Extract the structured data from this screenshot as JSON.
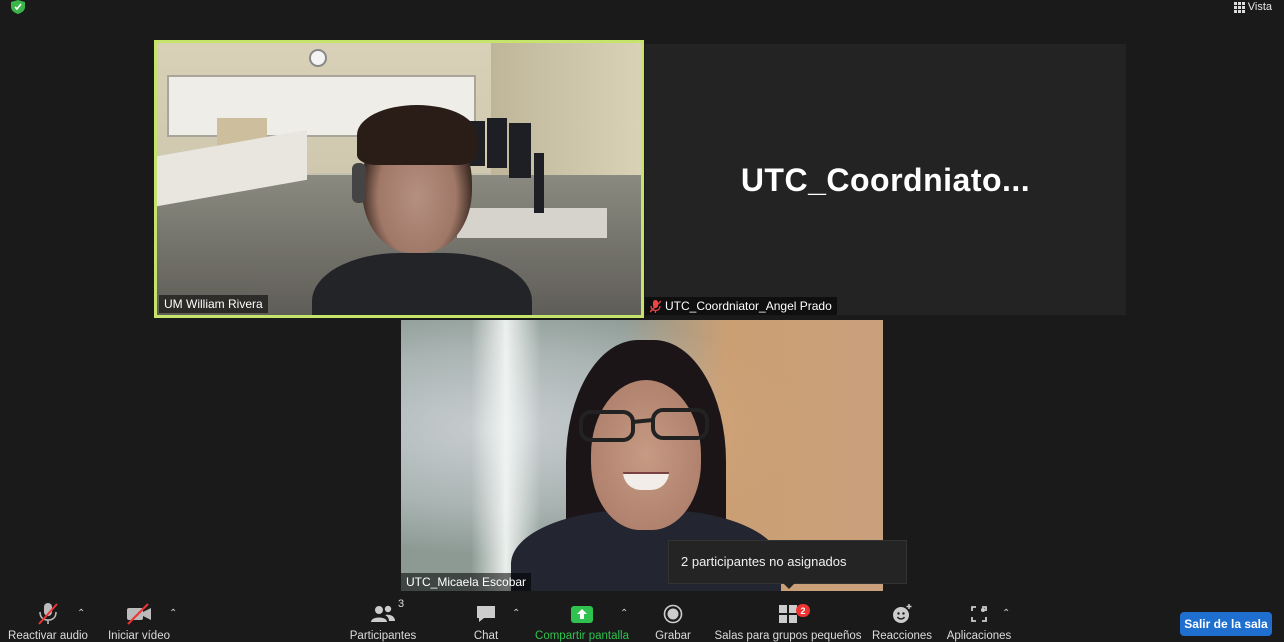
{
  "top_bar": {
    "view_label": "Vista",
    "icons": [
      "shield-icon",
      "grid-icon"
    ],
    "shield_color": "#3ab54a"
  },
  "participants": [
    {
      "name": "UM William Rivera",
      "video": true,
      "active_speaker": true,
      "highlight_color": "#c6e46b"
    },
    {
      "name": "UTC_Coordniator_Angel Prado",
      "display_name": "UTC_Coordniato...",
      "video": false,
      "muted": true
    },
    {
      "name": "UTC_Micaela Escobar",
      "video": true
    }
  ],
  "tooltip": {
    "text": "2 participantes no asignados"
  },
  "toolbar": {
    "audio": {
      "label": "Reactivar audio",
      "icon": "mic-muted-icon"
    },
    "video": {
      "label": "Iniciar vídeo",
      "icon": "video-off-icon"
    },
    "participants": {
      "label": "Participantes",
      "count": "3",
      "icon": "people-icon"
    },
    "chat": {
      "label": "Chat",
      "icon": "chat-icon"
    },
    "share": {
      "label": "Compartir pantalla",
      "icon": "share-screen-icon",
      "color": "#2fc24e"
    },
    "record": {
      "label": "Grabar",
      "icon": "record-icon"
    },
    "breakout": {
      "label": "Salas para grupos pequeños",
      "badge": "2",
      "icon": "breakout-rooms-icon"
    },
    "reactions": {
      "label": "Reacciones",
      "icon": "emoji-icon"
    },
    "apps": {
      "label": "Aplicaciones",
      "icon": "apps-icon"
    },
    "leave": {
      "label": "Salir de la sala",
      "color": "#1f6fd1"
    }
  }
}
